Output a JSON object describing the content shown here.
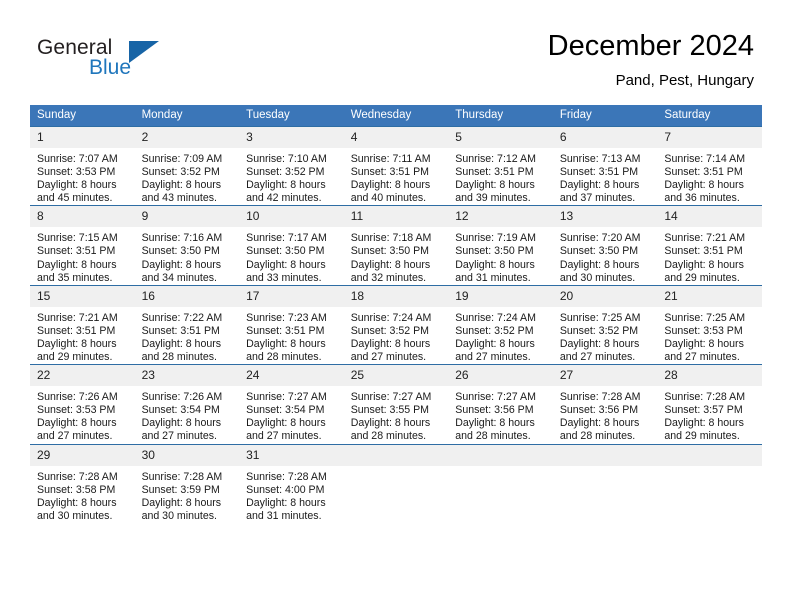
{
  "brand": {
    "name_top": "General",
    "name_bottom": "Blue",
    "accent_color": "#1f76bc",
    "triangle_color": "#1764a6"
  },
  "header": {
    "title": "December 2024",
    "subtitle": "Pand, Pest, Hungary"
  },
  "theme": {
    "header_row_bg": "#3b76b8",
    "row_divider": "#2e6da4",
    "daynum_bg": "#f0f0f0"
  },
  "weekdays": [
    "Sunday",
    "Monday",
    "Tuesday",
    "Wednesday",
    "Thursday",
    "Friday",
    "Saturday"
  ],
  "weeks": [
    [
      {
        "day": "1",
        "sunrise": "Sunrise: 7:07 AM",
        "sunset": "Sunset: 3:53 PM",
        "daylight1": "Daylight: 8 hours",
        "daylight2": "and 45 minutes."
      },
      {
        "day": "2",
        "sunrise": "Sunrise: 7:09 AM",
        "sunset": "Sunset: 3:52 PM",
        "daylight1": "Daylight: 8 hours",
        "daylight2": "and 43 minutes."
      },
      {
        "day": "3",
        "sunrise": "Sunrise: 7:10 AM",
        "sunset": "Sunset: 3:52 PM",
        "daylight1": "Daylight: 8 hours",
        "daylight2": "and 42 minutes."
      },
      {
        "day": "4",
        "sunrise": "Sunrise: 7:11 AM",
        "sunset": "Sunset: 3:51 PM",
        "daylight1": "Daylight: 8 hours",
        "daylight2": "and 40 minutes."
      },
      {
        "day": "5",
        "sunrise": "Sunrise: 7:12 AM",
        "sunset": "Sunset: 3:51 PM",
        "daylight1": "Daylight: 8 hours",
        "daylight2": "and 39 minutes."
      },
      {
        "day": "6",
        "sunrise": "Sunrise: 7:13 AM",
        "sunset": "Sunset: 3:51 PM",
        "daylight1": "Daylight: 8 hours",
        "daylight2": "and 37 minutes."
      },
      {
        "day": "7",
        "sunrise": "Sunrise: 7:14 AM",
        "sunset": "Sunset: 3:51 PM",
        "daylight1": "Daylight: 8 hours",
        "daylight2": "and 36 minutes."
      }
    ],
    [
      {
        "day": "8",
        "sunrise": "Sunrise: 7:15 AM",
        "sunset": "Sunset: 3:51 PM",
        "daylight1": "Daylight: 8 hours",
        "daylight2": "and 35 minutes."
      },
      {
        "day": "9",
        "sunrise": "Sunrise: 7:16 AM",
        "sunset": "Sunset: 3:50 PM",
        "daylight1": "Daylight: 8 hours",
        "daylight2": "and 34 minutes."
      },
      {
        "day": "10",
        "sunrise": "Sunrise: 7:17 AM",
        "sunset": "Sunset: 3:50 PM",
        "daylight1": "Daylight: 8 hours",
        "daylight2": "and 33 minutes."
      },
      {
        "day": "11",
        "sunrise": "Sunrise: 7:18 AM",
        "sunset": "Sunset: 3:50 PM",
        "daylight1": "Daylight: 8 hours",
        "daylight2": "and 32 minutes."
      },
      {
        "day": "12",
        "sunrise": "Sunrise: 7:19 AM",
        "sunset": "Sunset: 3:50 PM",
        "daylight1": "Daylight: 8 hours",
        "daylight2": "and 31 minutes."
      },
      {
        "day": "13",
        "sunrise": "Sunrise: 7:20 AM",
        "sunset": "Sunset: 3:50 PM",
        "daylight1": "Daylight: 8 hours",
        "daylight2": "and 30 minutes."
      },
      {
        "day": "14",
        "sunrise": "Sunrise: 7:21 AM",
        "sunset": "Sunset: 3:51 PM",
        "daylight1": "Daylight: 8 hours",
        "daylight2": "and 29 minutes."
      }
    ],
    [
      {
        "day": "15",
        "sunrise": "Sunrise: 7:21 AM",
        "sunset": "Sunset: 3:51 PM",
        "daylight1": "Daylight: 8 hours",
        "daylight2": "and 29 minutes."
      },
      {
        "day": "16",
        "sunrise": "Sunrise: 7:22 AM",
        "sunset": "Sunset: 3:51 PM",
        "daylight1": "Daylight: 8 hours",
        "daylight2": "and 28 minutes."
      },
      {
        "day": "17",
        "sunrise": "Sunrise: 7:23 AM",
        "sunset": "Sunset: 3:51 PM",
        "daylight1": "Daylight: 8 hours",
        "daylight2": "and 28 minutes."
      },
      {
        "day": "18",
        "sunrise": "Sunrise: 7:24 AM",
        "sunset": "Sunset: 3:52 PM",
        "daylight1": "Daylight: 8 hours",
        "daylight2": "and 27 minutes."
      },
      {
        "day": "19",
        "sunrise": "Sunrise: 7:24 AM",
        "sunset": "Sunset: 3:52 PM",
        "daylight1": "Daylight: 8 hours",
        "daylight2": "and 27 minutes."
      },
      {
        "day": "20",
        "sunrise": "Sunrise: 7:25 AM",
        "sunset": "Sunset: 3:52 PM",
        "daylight1": "Daylight: 8 hours",
        "daylight2": "and 27 minutes."
      },
      {
        "day": "21",
        "sunrise": "Sunrise: 7:25 AM",
        "sunset": "Sunset: 3:53 PM",
        "daylight1": "Daylight: 8 hours",
        "daylight2": "and 27 minutes."
      }
    ],
    [
      {
        "day": "22",
        "sunrise": "Sunrise: 7:26 AM",
        "sunset": "Sunset: 3:53 PM",
        "daylight1": "Daylight: 8 hours",
        "daylight2": "and 27 minutes."
      },
      {
        "day": "23",
        "sunrise": "Sunrise: 7:26 AM",
        "sunset": "Sunset: 3:54 PM",
        "daylight1": "Daylight: 8 hours",
        "daylight2": "and 27 minutes."
      },
      {
        "day": "24",
        "sunrise": "Sunrise: 7:27 AM",
        "sunset": "Sunset: 3:54 PM",
        "daylight1": "Daylight: 8 hours",
        "daylight2": "and 27 minutes."
      },
      {
        "day": "25",
        "sunrise": "Sunrise: 7:27 AM",
        "sunset": "Sunset: 3:55 PM",
        "daylight1": "Daylight: 8 hours",
        "daylight2": "and 28 minutes."
      },
      {
        "day": "26",
        "sunrise": "Sunrise: 7:27 AM",
        "sunset": "Sunset: 3:56 PM",
        "daylight1": "Daylight: 8 hours",
        "daylight2": "and 28 minutes."
      },
      {
        "day": "27",
        "sunrise": "Sunrise: 7:28 AM",
        "sunset": "Sunset: 3:56 PM",
        "daylight1": "Daylight: 8 hours",
        "daylight2": "and 28 minutes."
      },
      {
        "day": "28",
        "sunrise": "Sunrise: 7:28 AM",
        "sunset": "Sunset: 3:57 PM",
        "daylight1": "Daylight: 8 hours",
        "daylight2": "and 29 minutes."
      }
    ],
    [
      {
        "day": "29",
        "sunrise": "Sunrise: 7:28 AM",
        "sunset": "Sunset: 3:58 PM",
        "daylight1": "Daylight: 8 hours",
        "daylight2": "and 30 minutes."
      },
      {
        "day": "30",
        "sunrise": "Sunrise: 7:28 AM",
        "sunset": "Sunset: 3:59 PM",
        "daylight1": "Daylight: 8 hours",
        "daylight2": "and 30 minutes."
      },
      {
        "day": "31",
        "sunrise": "Sunrise: 7:28 AM",
        "sunset": "Sunset: 4:00 PM",
        "daylight1": "Daylight: 8 hours",
        "daylight2": "and 31 minutes."
      },
      {
        "day": "",
        "sunrise": "",
        "sunset": "",
        "daylight1": "",
        "daylight2": ""
      },
      {
        "day": "",
        "sunrise": "",
        "sunset": "",
        "daylight1": "",
        "daylight2": ""
      },
      {
        "day": "",
        "sunrise": "",
        "sunset": "",
        "daylight1": "",
        "daylight2": ""
      },
      {
        "day": "",
        "sunrise": "",
        "sunset": "",
        "daylight1": "",
        "daylight2": ""
      }
    ]
  ]
}
